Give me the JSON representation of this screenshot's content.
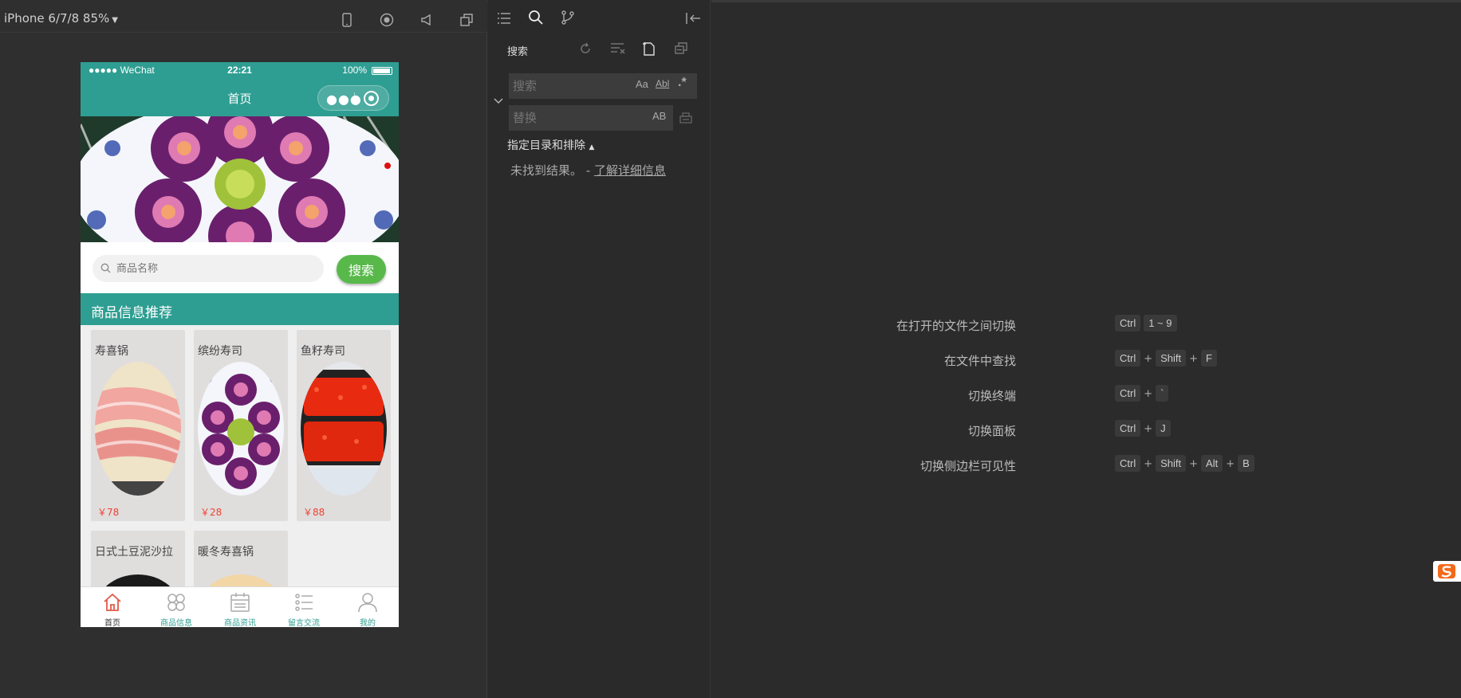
{
  "simulator": {
    "device_label": "iPhone 6/7/8 85%",
    "status": {
      "carrier": "●●●●● WeChat",
      "time": "22:21",
      "battery": "100%"
    },
    "nav_title": "首页",
    "search_placeholder": "商品名称",
    "search_button": "搜索",
    "section_title": "商品信息推荐",
    "products": [
      {
        "name": "寿喜锅",
        "price": "￥78"
      },
      {
        "name": "缤纷寿司",
        "price": "￥28"
      },
      {
        "name": "鱼籽寿司",
        "price": "￥88"
      },
      {
        "name": "日式土豆泥沙拉",
        "price": ""
      },
      {
        "name": "暖冬寿喜锅",
        "price": ""
      }
    ],
    "tabs": [
      {
        "label": "首页",
        "icon": "home-icon"
      },
      {
        "label": "商品信息",
        "icon": "grid-icon"
      },
      {
        "label": "商品资讯",
        "icon": "calendar-icon"
      },
      {
        "label": "留言交流",
        "icon": "list-icon"
      },
      {
        "label": "我的",
        "icon": "user-icon"
      }
    ]
  },
  "search_panel": {
    "header": "搜索",
    "find_placeholder": "搜索",
    "replace_placeholder": "替换",
    "options": {
      "match_case": "Aa",
      "whole_word": "Abl",
      "regex": ".*",
      "preserve_case": "AB"
    },
    "scope_label": "指定目录和排除",
    "no_result": "未找到结果。 - ",
    "learn_more": "了解详细信息"
  },
  "shortcuts": [
    {
      "label": "在打开的文件之间切换",
      "keys": [
        "Ctrl",
        "1 ~ 9"
      ]
    },
    {
      "label": "在文件中查找",
      "keys": [
        "Ctrl",
        "Shift",
        "F"
      ]
    },
    {
      "label": "切换终端",
      "keys": [
        "Ctrl",
        "`"
      ]
    },
    {
      "label": "切换面板",
      "keys": [
        "Ctrl",
        "J"
      ]
    },
    {
      "label": "切换侧边栏可见性",
      "keys": [
        "Ctrl",
        "Shift",
        "Alt",
        "B"
      ]
    }
  ],
  "colors": {
    "accent": "#2f9e92",
    "search_button": "#58b94a",
    "price": "#ee4433"
  }
}
